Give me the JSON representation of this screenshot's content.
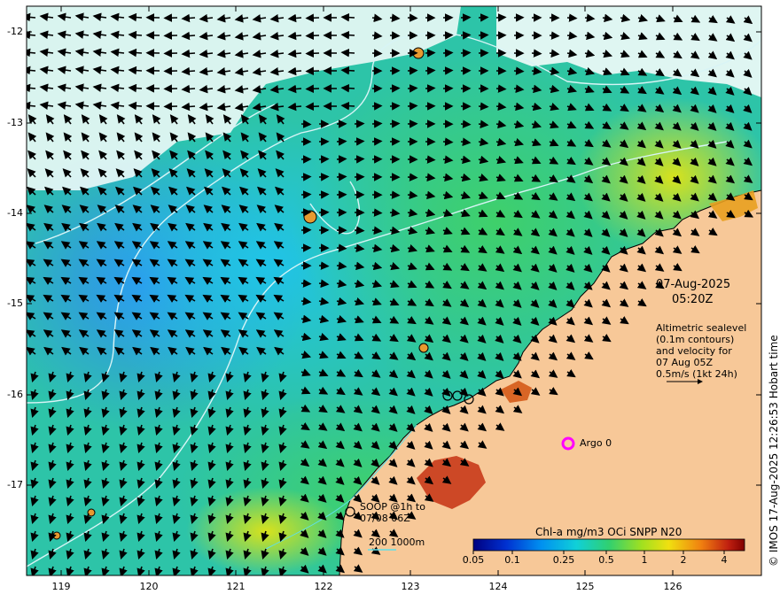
{
  "map": {
    "timestamp_date": "07-Aug-2025",
    "timestamp_time": "05:20Z",
    "lat_ticks": [
      "-12",
      "-13",
      "-14",
      "-15",
      "-16",
      "-17"
    ],
    "lon_ticks": [
      "119",
      "120",
      "121",
      "122",
      "123",
      "124",
      "125",
      "126"
    ],
    "info_lines": [
      "Altimetric sealevel",
      "(0.1m contours)",
      "and velocity for",
      "07 Aug 05Z",
      "0.5m/s (1kt 24h)"
    ],
    "argo_label": "Argo 0",
    "soop_line1": "SOOP @1h to",
    "soop_line2": "07/08 06Z",
    "depth_label": "200  1000m",
    "colorbar_title": "Chl-a mg/m3 OCi SNPP N20",
    "colorbar_ticks": [
      "0.05",
      "0.1",
      "0.25",
      "0.5",
      "1",
      "2",
      "4"
    ],
    "credit": "© IMOS 17-Aug-2025 12:26:53 Hobart time",
    "colors": {
      "land": "#f7c898",
      "ocean_blue": "#2aa8e8",
      "ocean_green": "#2ec98a",
      "argo": "#ff00ff",
      "contour": "#d8f4f6"
    }
  }
}
